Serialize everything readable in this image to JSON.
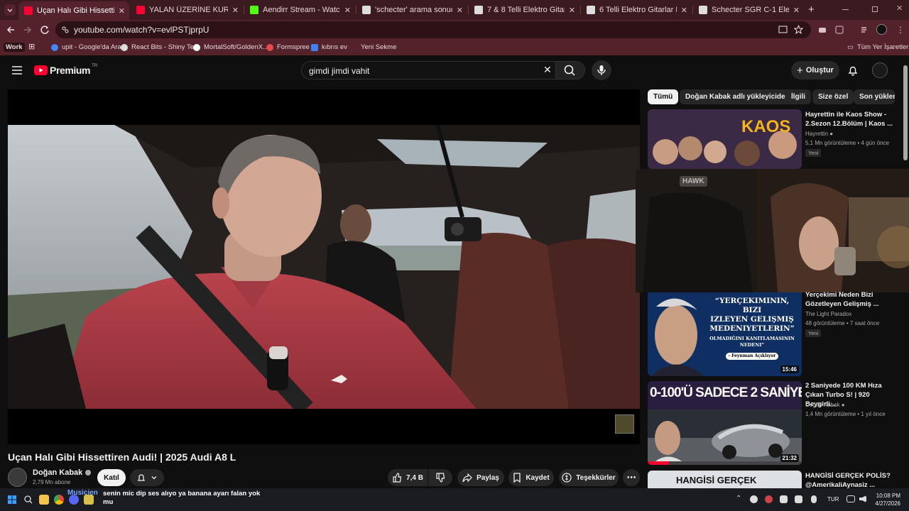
{
  "browser": {
    "tabs": [
      {
        "title": "Uçan Halı Gibi Hissettiren Audi!",
        "favicon_color": "#ff0033",
        "active": true
      },
      {
        "title": "YALAN ÜZERİNE KURULMUŞ K/",
        "favicon_color": "#ff0033",
        "active": false
      },
      {
        "title": "Aendirr Stream - Watch Live on",
        "favicon_color": "#53fc18",
        "active": false
      },
      {
        "title": "'schecter' arama sonuçları | do",
        "favicon_color": "#dddddd",
        "active": false
      },
      {
        "title": "7 & 8 Telli Elektro Gitarlar Fiyat",
        "favicon_color": "#dddddd",
        "active": false
      },
      {
        "title": "6 Telli Elektro Gitarlar Fiyatları v",
        "favicon_color": "#dddddd",
        "active": false
      },
      {
        "title": "Schecter SGR C-1 Elektro Gitar",
        "favicon_color": "#dddddd",
        "active": false
      }
    ],
    "new_tab": "+",
    "url": "youtube.com/watch?v=evlPSTjprpU",
    "bookmarks": {
      "work": "Work",
      "items": [
        {
          "label": "upit - Google'da Ara",
          "color": "#4285f4"
        },
        {
          "label": "React Bits - Shiny Text",
          "color": "#dddddd"
        },
        {
          "label": "MortalSoft/GoldenX...",
          "color": "#ffffff"
        },
        {
          "label": "Formspree",
          "color": "#e5484d"
        },
        {
          "label": "kıbrıs ev",
          "color": "#3b82f6"
        },
        {
          "label": "Yeni Sekme",
          "color": "#53222b"
        }
      ],
      "all": "Tüm Yer İşaretleri"
    }
  },
  "youtube": {
    "logo": "Premium",
    "region": "TR",
    "search_value": "gimdi jimdi vahit",
    "create_label": "Oluştur",
    "video": {
      "title": "Uçan Halı Gibi Hissettiren Audi! | 2025 Audi A8 L",
      "channel": "Doğan Kabak",
      "subscribers": "2,79 Mn abone",
      "join": "Katıl",
      "likes": "7,4 B",
      "share": "Paylaş",
      "save": "Kaydet",
      "thanks": "Teşekkürler"
    },
    "chips": [
      "Tümü",
      "Doğan Kabak adlı yükleyiciden",
      "İlgili",
      "Size özel",
      "Son yüklene"
    ],
    "recommendations": [
      {
        "title_1": "Hayrettin ile Kaos Show -",
        "title_2": "2.Sezon 12.Bölüm | Kaos ...",
        "channel": "Hayrettin",
        "meta": "5,1 Mn görüntüleme • 4 gün önce",
        "badge": "Yeni",
        "thumb_text": "KAOS"
      },
      {
        "title_1": "Yerçekimi Neden Bizi",
        "title_2": "Gözetleyen Gelişmiş ...",
        "channel": "The Light Paradox",
        "meta": "48 görüntüleme • 7 saat önce",
        "badge": "Yeni",
        "duration": "15:46",
        "thumb_text_1": "“YERÇEKIMININ, BIZI",
        "thumb_text_2": "IZLEYEN GELIŞMIŞ",
        "thumb_text_3": "MEDENIYETLERIN”",
        "thumb_text_4": "OLMADIĞINI KANITLAMASININ",
        "thumb_text_5": "NEDENI”",
        "thumb_text_6": "- Feynman Açıklıyor"
      },
      {
        "title_1": "2 Saniyede 100 KM Hıza",
        "title_2": "Çıkan Turbo S! | 920 Beygirli...",
        "channel": "Doğan Kabak",
        "meta": "1,4 Mn görüntüleme • 1 yıl önce",
        "duration": "21:32",
        "thumb_text": "0-100'Ü SADECE 2 SANİYE"
      },
      {
        "title_1": "HANGİSİ GERÇEK POLİS?",
        "title_2": "@AmerikaliAynasiz ...",
        "thumb_text": "HANGİSİ GERÇEK"
      }
    ],
    "overlay_logo": "HAWK"
  },
  "taskbar": {
    "notification_title": "Musicien",
    "notification_text_1": "senin mic dip ses alıyo ya banana ayarı falan yok",
    "notification_text_2": "mu",
    "lang": "TUR",
    "time": "10:08 PM",
    "date": "4/27/2026"
  }
}
